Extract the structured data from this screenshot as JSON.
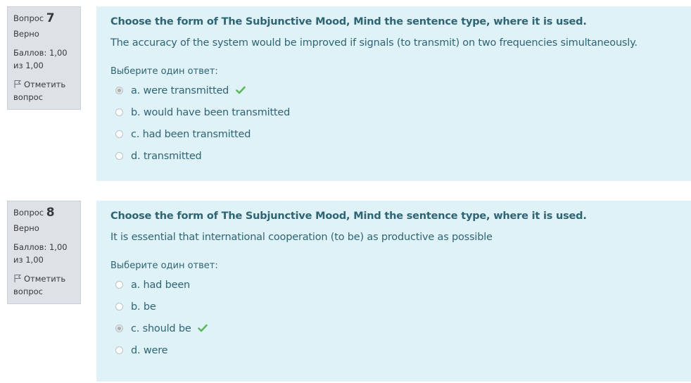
{
  "questions": [
    {
      "info": {
        "label": "Вопрос",
        "number": "7",
        "state": "Верно",
        "grade": "Баллов: 1,00 из 1,00",
        "flag_label": "Отметить вопрос"
      },
      "title": "Choose the form of The Subjunctive Mood, Mind the sentence type, where it is used.",
      "text": "The accuracy of the system would be  improved if signals (to transmit) on two frequencies simultaneously.",
      "prompt": "Выберите один ответ:",
      "options": [
        {
          "label": "a. were transmitted",
          "selected": true,
          "correct": true
        },
        {
          "label": "b. would have been transmitted",
          "selected": false,
          "correct": false
        },
        {
          "label": "c. had been transmitted",
          "selected": false,
          "correct": false
        },
        {
          "label": "d. transmitted",
          "selected": false,
          "correct": false
        }
      ]
    },
    {
      "info": {
        "label": "Вопрос",
        "number": "8",
        "state": "Верно",
        "grade": "Баллов: 1,00 из 1,00",
        "flag_label": "Отметить вопрос"
      },
      "title": "Choose the form of The Subjunctive Mood, Mind the sentence type, where it is used.",
      "text": "It is essential that international cooperation (to be) as productive as possible",
      "prompt": "Выберите один ответ:",
      "options": [
        {
          "label": "a. had been",
          "selected": false,
          "correct": false
        },
        {
          "label": "b. be",
          "selected": false,
          "correct": false
        },
        {
          "label": "c. should be",
          "selected": true,
          "correct": true
        },
        {
          "label": "d. were",
          "selected": false,
          "correct": false
        }
      ]
    }
  ],
  "colors": {
    "info_bg": "#dee2e6",
    "content_bg": "#def2f8",
    "content_text": "#2f6473",
    "check": "#5cb85c"
  },
  "icons": {
    "flag": "flag-icon",
    "correct": "check-icon"
  }
}
